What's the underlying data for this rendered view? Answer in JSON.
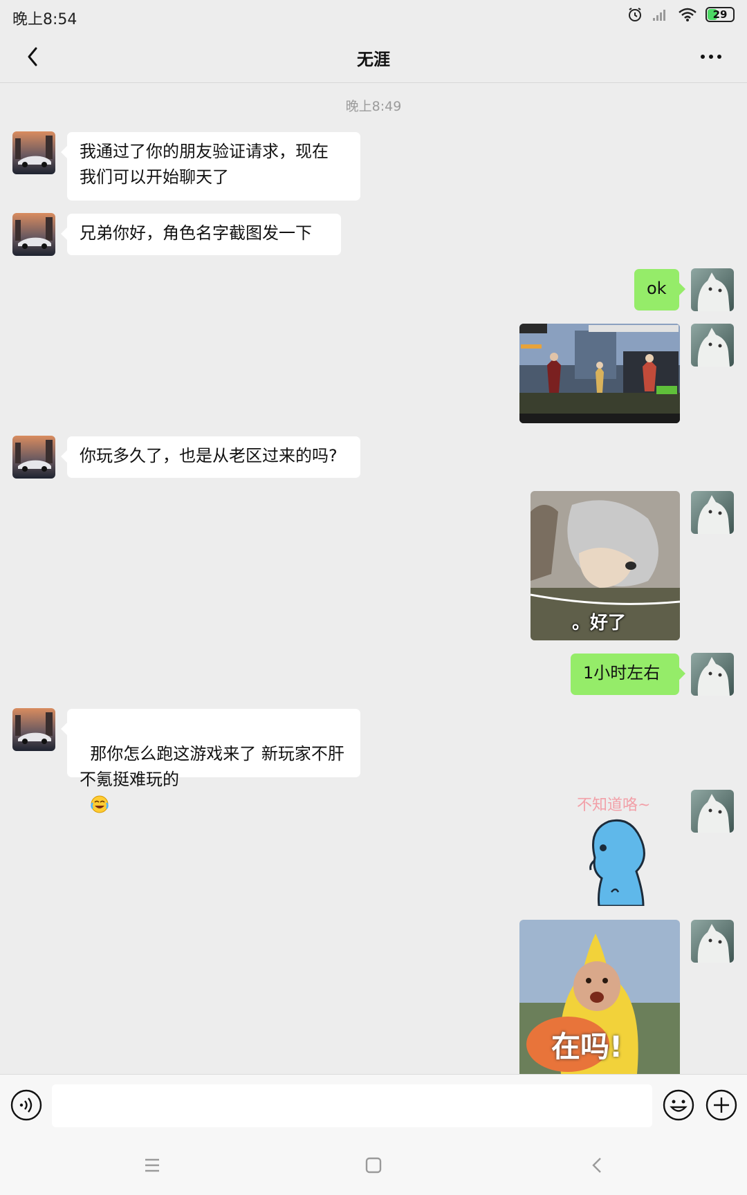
{
  "status_bar": {
    "time": "晚上8:54",
    "battery": "29",
    "icons": [
      "alarm-icon",
      "signal-icon",
      "wifi-icon",
      "battery-icon"
    ]
  },
  "nav": {
    "title": "无涯",
    "back_icon": "chevron-left-icon",
    "more_icon": "more-dots-icon"
  },
  "chat": {
    "timestamp": "晚上8:49",
    "messages": [
      {
        "from": "contact",
        "type": "text",
        "text": "我通过了你的朋友验证请求，现在\n我们可以开始聊天了"
      },
      {
        "from": "contact",
        "type": "text",
        "text": "兄弟你好，角色名字截图发一下"
      },
      {
        "from": "me",
        "type": "text",
        "text": "ok"
      },
      {
        "from": "me",
        "type": "image",
        "description": "game-screenshot"
      },
      {
        "from": "contact",
        "type": "text",
        "text": "你玩多久了，也是从老区过来的吗?"
      },
      {
        "from": "me",
        "type": "sticker",
        "caption": "。好了"
      },
      {
        "from": "me",
        "type": "text",
        "text": "1小时左右"
      },
      {
        "from": "contact",
        "type": "text",
        "text": "那你怎么跑这游戏来了 新玩家不肝\n不氪挺难玩的",
        "emoji": "laughing-crying-emoji"
      },
      {
        "from": "me",
        "type": "sticker",
        "caption": "不知道咯~"
      },
      {
        "from": "me",
        "type": "sticker",
        "caption": "在吗!"
      }
    ]
  },
  "input_bar": {
    "voice_icon": "voice-icon",
    "emoji_icon": "emoji-icon",
    "plus_icon": "plus-icon",
    "value": ""
  },
  "system_nav": {
    "menu_icon": "menu-icon",
    "home_icon": "home-icon",
    "back_icon": "back-icon"
  },
  "colors": {
    "background": "#ededed",
    "incoming_bubble": "#ffffff",
    "outgoing_bubble": "#95ec69"
  }
}
